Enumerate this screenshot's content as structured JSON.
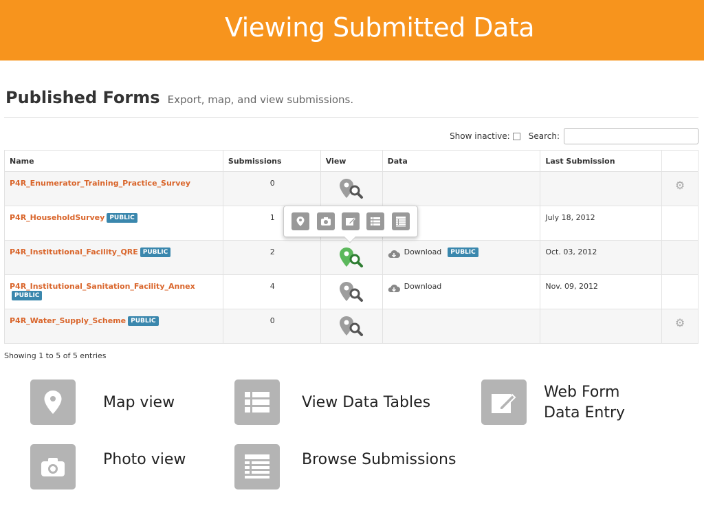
{
  "banner": {
    "title": "Viewing Submitted Data"
  },
  "header": {
    "title": "Published Forms",
    "subtitle": "Export, map, and view submissions."
  },
  "filters": {
    "show_inactive_label": "Show inactive:",
    "search_label": "Search:",
    "search_value": ""
  },
  "table": {
    "columns": [
      "Name",
      "Submissions",
      "View",
      "Data",
      "Last Submission",
      ""
    ],
    "rows": [
      {
        "name": "P4R_Enumerator_Training_Practice_Survey",
        "public": "",
        "submissions": "0",
        "data": "",
        "data_public": "",
        "last": ""
      },
      {
        "name": "P4R_HouseholdSurvey",
        "public": "PUBLIC",
        "submissions": "1",
        "data": "",
        "data_public": "",
        "last": "July 18, 2012"
      },
      {
        "name": "P4R_Institutional_Facility_QRE",
        "public": "PUBLIC",
        "submissions": "2",
        "data": "Download",
        "data_public": "PUBLIC",
        "last": "Oct. 03, 2012"
      },
      {
        "name": "P4R_Institutional_Sanitation_Facility_Annex",
        "public": "PUBLIC",
        "submissions": "4",
        "data": "Download",
        "data_public": "",
        "last": "Nov. 09, 2012"
      },
      {
        "name": "P4R_Water_Supply_Scheme",
        "public": "PUBLIC",
        "submissions": "0",
        "data": "",
        "data_public": "",
        "last": ""
      }
    ],
    "info": "Showing 1 to 5 of 5 entries"
  },
  "popover": {
    "buttons": [
      "map-icon",
      "camera-icon",
      "edit-icon",
      "table-list-icon",
      "browse-list-icon"
    ]
  },
  "legend": {
    "map": "Map view",
    "photo": "Photo view",
    "tables": "View Data Tables",
    "browse": "Browse Submissions",
    "webform_line1": "Web Form",
    "webform_line2": "Data Entry"
  },
  "colors": {
    "banner": "#f7941d",
    "link": "#d9652b",
    "badge": "#3a87ad",
    "icon_gray": "#b4b4b4",
    "map_active": "#5cb85c"
  }
}
